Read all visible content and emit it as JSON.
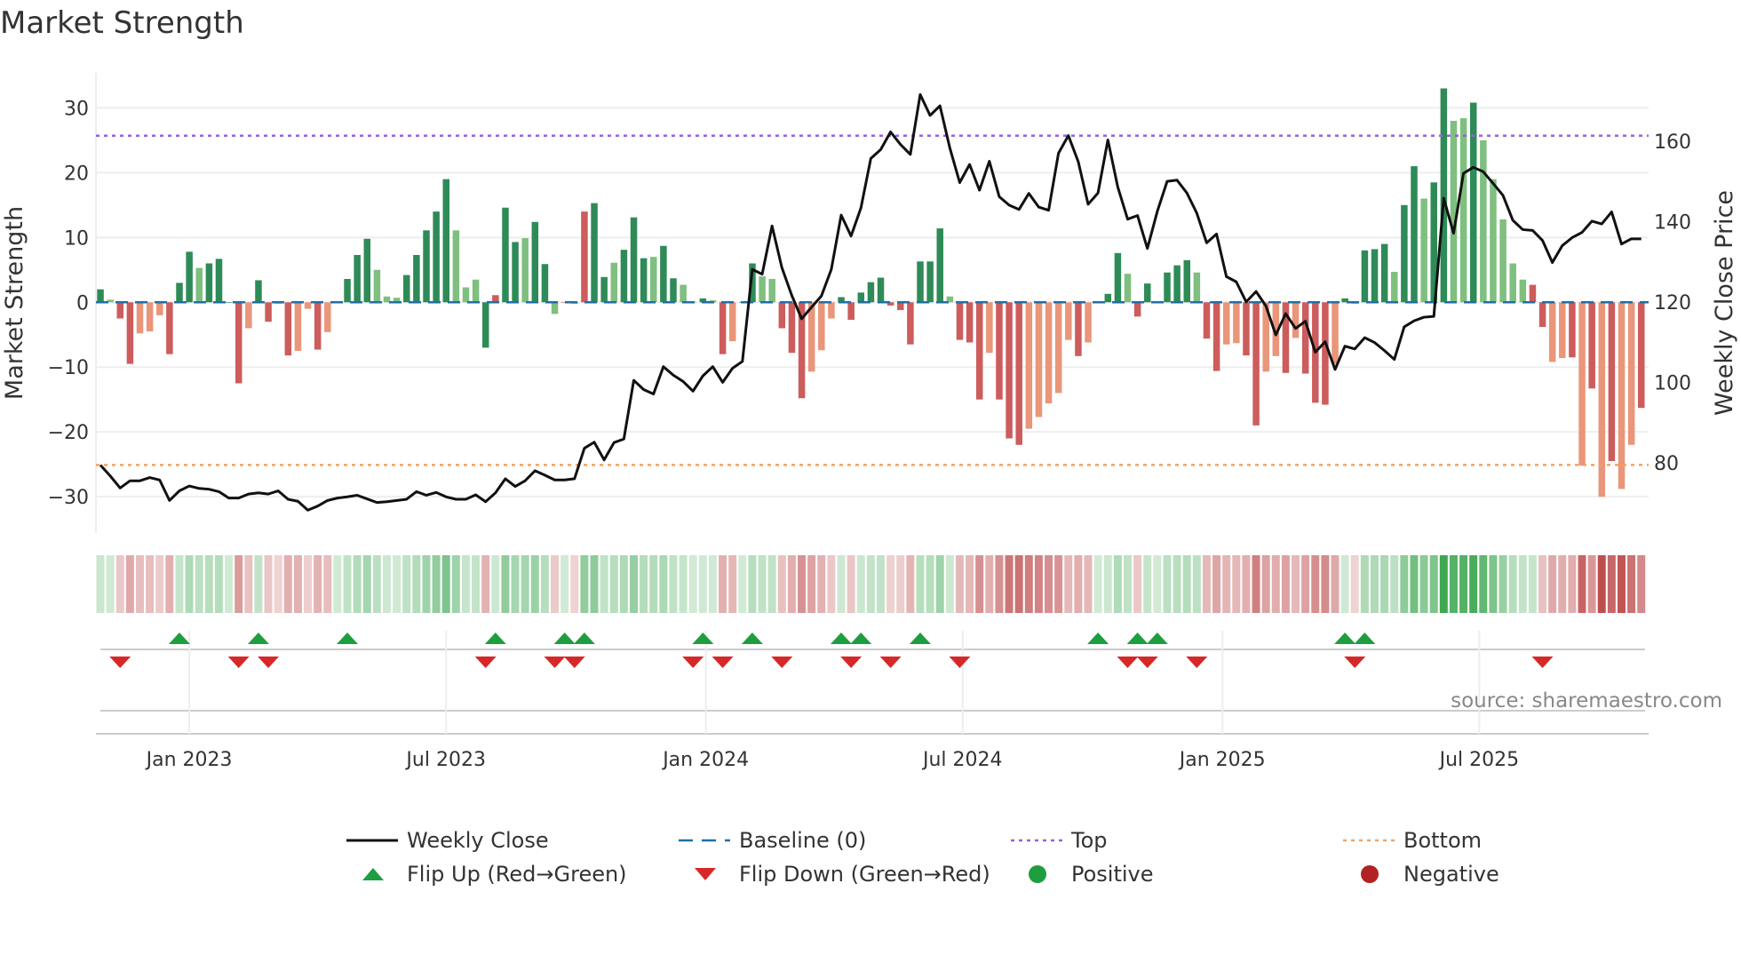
{
  "chart_data": {
    "type": "bar",
    "title": "Market Strength",
    "ylabel": "Market Strength",
    "y2label": "Weekly Close Price",
    "ylim": [
      -35.6,
      35.4
    ],
    "y2lim": [
      62.5,
      177
    ],
    "yticks": [
      30,
      20,
      10,
      0,
      -10,
      -20,
      -30
    ],
    "ytick_labels": [
      "30",
      "20",
      "10",
      "0",
      "−10",
      "−20",
      "−30"
    ],
    "y2ticks": [
      160,
      140,
      120,
      100,
      80
    ],
    "y2tick_labels": [
      "160",
      "140",
      "120",
      "100",
      "80"
    ],
    "xticks": [
      {
        "label": "Jan 2023",
        "week": 9
      },
      {
        "label": "Jul 2023",
        "week": 35
      },
      {
        "label": "Jan 2024",
        "week": 61.3
      },
      {
        "label": "Jul 2024",
        "week": 87.3
      },
      {
        "label": "Jan 2025",
        "week": 113.6
      },
      {
        "label": "Jul 2025",
        "week": 139.6
      }
    ],
    "top_level": 25.7,
    "bottom_level": -25.1,
    "baseline": 0,
    "strength": [
      2,
      0.4,
      -2.5,
      -9.5,
      -4.8,
      -4.5,
      -2,
      -8,
      3,
      7.8,
      5.3,
      6,
      6.7,
      0,
      -12.5,
      -4,
      3.4,
      -3,
      -0.2,
      -8.2,
      -7.5,
      -1,
      -7.3,
      -4.6,
      0,
      3.6,
      7.3,
      9.8,
      5,
      0.9,
      0.7,
      4.2,
      7.3,
      11.1,
      14,
      19,
      11.1,
      2.3,
      3.5,
      -7,
      1.1,
      14.6,
      9.3,
      9.9,
      12.4,
      5.9,
      -1.8,
      0,
      -0.2,
      14,
      15.3,
      3.9,
      6.1,
      8.1,
      13.1,
      6.8,
      7,
      8.7,
      3.7,
      2.7,
      0,
      0.6,
      0.3,
      -8,
      -6,
      0,
      6,
      4,
      3.6,
      -4,
      -7.8,
      -14.8,
      -10.7,
      -7.4,
      -2.5,
      0.8,
      -2.7,
      1.5,
      3.1,
      3.8,
      -0.5,
      -1.2,
      -6.5,
      6.3,
      6.3,
      11.4,
      0.9,
      -5.8,
      -6.2,
      -15,
      -7.8,
      -15,
      -21,
      -22,
      -19.5,
      -17.7,
      -15.6,
      -14,
      -5.8,
      -8.3,
      -6.2,
      0,
      1.3,
      7.6,
      4.4,
      -2.2,
      2.9,
      0,
      4.6,
      5.7,
      6.5,
      4.6,
      -5.6,
      -10.6,
      -6.5,
      -6.3,
      -8.2,
      -19,
      -10.7,
      -8.3,
      -10.9,
      -5.5,
      -11,
      -15.5,
      -15.8,
      -9.5,
      0.6,
      -0.2,
      8,
      8.2,
      9,
      4.7,
      15,
      21,
      16,
      18.5,
      33,
      28,
      28.4,
      30.8,
      25,
      19,
      12.8,
      6,
      3.5,
      2.7,
      -3.8,
      -9.2,
      -8.6,
      -8.5,
      -25.2,
      -13.3,
      -30,
      -24.5,
      -28.8,
      -22,
      -16.3
    ],
    "bar_color_class": "GgRRrrrRGGgGGGRrGRRRrrRrGGGGgggGGGGGgggGRGGgGGgRGRGGgGGGgGGggGgRrGGggRRRrrrGRGGGRRRGGGgRRRrRRRrrrrrRrGGGgRGGGGGgRRrrRRrrRrRRRrGRGGGgGGgGGggGgggggRRrrRrRrRrr",
    "bar_colors": {
      "G": "#2e8b57",
      "g": "#7fbf7f",
      "R": "#cd5c5c",
      "r": "#e9967a"
    },
    "weekly_close": [
      79.4,
      76.7,
      73.7,
      75.5,
      75.5,
      76.3,
      75.7,
      70.6,
      73,
      74.2,
      73.6,
      73.4,
      72.8,
      71.2,
      71.2,
      72.2,
      72.5,
      72.2,
      73,
      70.9,
      70.4,
      68.2,
      69.2,
      70.6,
      71.2,
      71.5,
      71.9,
      71,
      70.1,
      70.3,
      70.6,
      70.9,
      72.8,
      71.9,
      72.6,
      71.5,
      70.9,
      70.9,
      72,
      70.3,
      72.5,
      76,
      74.1,
      75.5,
      78,
      76.9,
      75.7,
      75.7,
      76,
      83.6,
      85.1,
      80.7,
      85,
      85.9,
      100.5,
      98.2,
      97.1,
      103.9,
      101.8,
      100.2,
      97.8,
      101.6,
      103.9,
      100,
      103.5,
      105.2,
      128.1,
      126.9,
      138.9,
      128.5,
      121.6,
      115.8,
      118.7,
      121.5,
      128.1,
      141.6,
      136.4,
      143.4,
      155.7,
      157.9,
      162.3,
      159.2,
      156.7,
      171.6,
      166.4,
      168.8,
      158.3,
      149.7,
      154.2,
      147.8,
      155,
      146.2,
      144.1,
      143,
      147,
      143.6,
      142.8,
      157,
      161.4,
      154.9,
      144.3,
      147.1,
      160.3,
      148.6,
      140.6,
      141.5,
      133.3,
      142.5,
      150,
      150.3,
      147.1,
      142.1,
      134.7,
      136.9,
      126.3,
      125,
      120,
      122.6,
      119,
      111.8,
      117.1,
      113.4,
      115.2,
      107.5,
      110.1,
      103.2,
      109,
      108.3,
      111.1,
      109.9,
      107.9,
      105.7,
      113.8,
      115.3,
      116.2,
      116.4,
      145.8,
      137.1,
      152,
      153.5,
      152.4,
      149.5,
      146.5,
      140.3,
      138,
      137.8,
      135.3,
      129.8,
      134,
      136,
      137.3,
      140.1,
      139.4,
      142.4,
      134.4,
      135.7,
      135.7
    ],
    "flip_up_weeks": [
      8,
      16,
      25,
      40,
      47,
      49,
      61,
      66,
      75,
      77,
      83,
      101,
      105,
      107,
      126,
      128
    ],
    "flip_down_weeks": [
      2,
      14,
      17,
      39,
      46,
      48,
      60,
      63,
      69,
      76,
      80,
      87,
      104,
      106,
      111,
      127,
      146
    ],
    "colors": {
      "close": "#111111",
      "baseline": "#1f6fa8",
      "top": "#9b5de5",
      "bottom": "#f4a261",
      "flip_up": "#1e9e3e",
      "flip_down": "#d62828",
      "positive": "#1e9e3e",
      "negative": "#b22222"
    },
    "source": "source: sharemaestro.com",
    "legend": [
      {
        "key": "close",
        "label": "Weekly Close"
      },
      {
        "key": "baseline",
        "label": "Baseline (0)"
      },
      {
        "key": "top",
        "label": "Top"
      },
      {
        "key": "bottom",
        "label": "Bottom"
      },
      {
        "key": "flip_up",
        "label": "Flip Up (Red→Green)"
      },
      {
        "key": "flip_down",
        "label": "Flip Down (Green→Red)"
      },
      {
        "key": "positive",
        "label": "Positive"
      },
      {
        "key": "negative",
        "label": "Negative"
      }
    ]
  }
}
